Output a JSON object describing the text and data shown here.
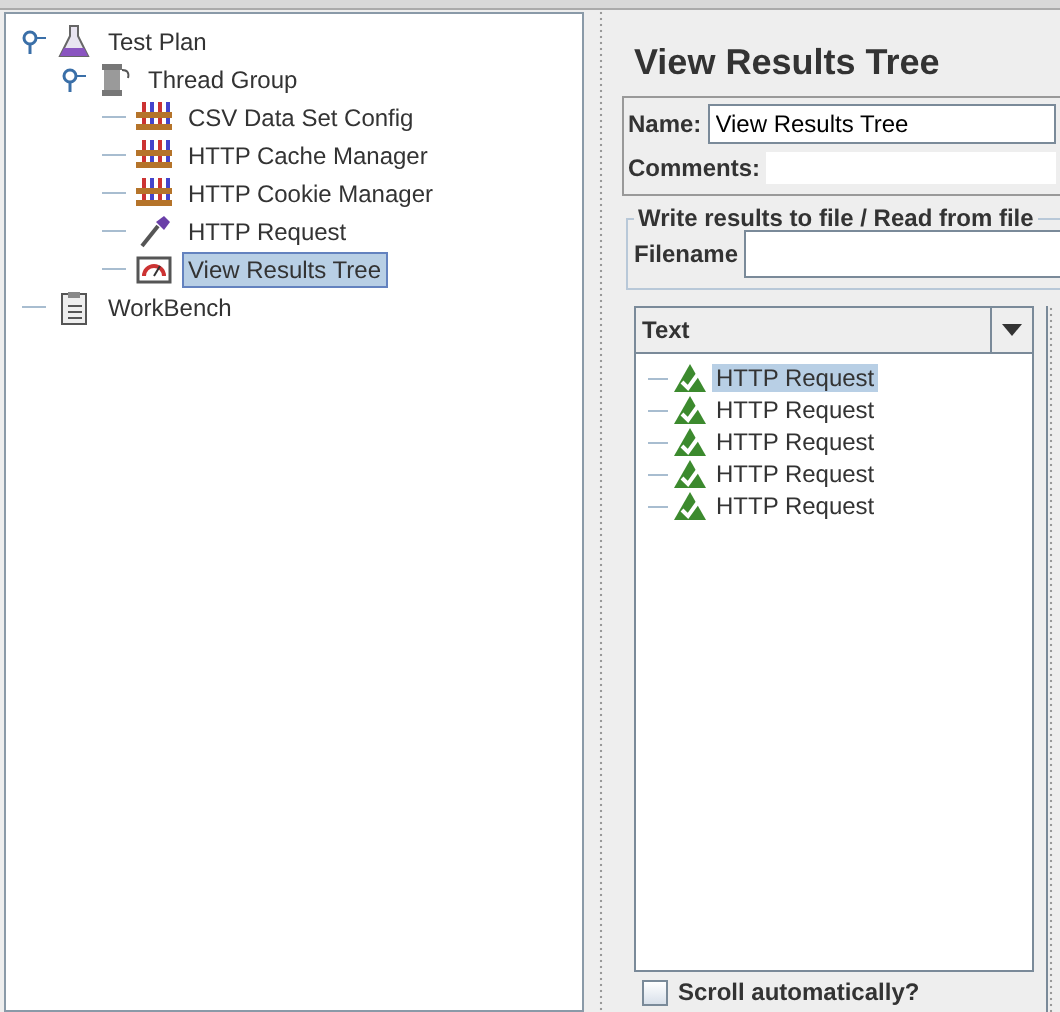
{
  "tree": [
    {
      "label": "Test Plan",
      "kind": "plan",
      "expanded": true,
      "selected": false,
      "children": [
        {
          "label": "Thread Group",
          "kind": "threads",
          "expanded": true,
          "selected": false,
          "children": [
            {
              "label": "CSV Data Set Config",
              "kind": "config",
              "selected": false
            },
            {
              "label": "HTTP Cache Manager",
              "kind": "config",
              "selected": false
            },
            {
              "label": "HTTP Cookie Manager",
              "kind": "config",
              "selected": false
            },
            {
              "label": "HTTP Request",
              "kind": "sampler",
              "selected": false
            },
            {
              "label": "View Results Tree",
              "kind": "listener",
              "selected": true
            }
          ]
        }
      ]
    },
    {
      "label": "WorkBench",
      "kind": "workbench",
      "selected": false
    }
  ],
  "panel": {
    "title": "View Results Tree",
    "name_label": "Name:",
    "name_value": "View Results Tree",
    "comments_label": "Comments:",
    "file_group": "Write results to file / Read from file",
    "filename_label": "Filename",
    "renderer": "Text",
    "results": [
      {
        "label": "HTTP Request",
        "selected": true
      },
      {
        "label": "HTTP Request",
        "selected": false
      },
      {
        "label": "HTTP Request",
        "selected": false
      },
      {
        "label": "HTTP Request",
        "selected": false
      },
      {
        "label": "HTTP Request",
        "selected": false
      }
    ],
    "scroll_label": "Scroll automatically?",
    "scroll_checked": false
  }
}
